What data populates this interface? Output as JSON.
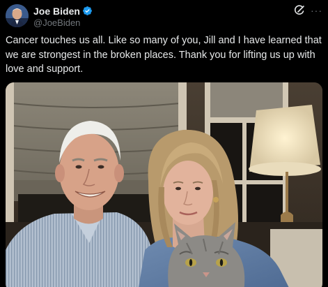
{
  "author": {
    "display_name": "Joe Biden",
    "handle": "@JoeBiden",
    "verified": true
  },
  "icons": {
    "verified": "verified-badge-icon",
    "grok": "grok-icon",
    "more": "more-options-icon"
  },
  "more_glyph": "···",
  "tweet": {
    "text": "Cancer touches us all. Like so many of you, Jill and I have learned that we are strongest in the broken places. Thank you for lifting us up with love and support."
  },
  "colors": {
    "background": "#000000",
    "text": "#e7e9ea",
    "secondary": "#71767b",
    "verified": "#1d9bf0"
  }
}
